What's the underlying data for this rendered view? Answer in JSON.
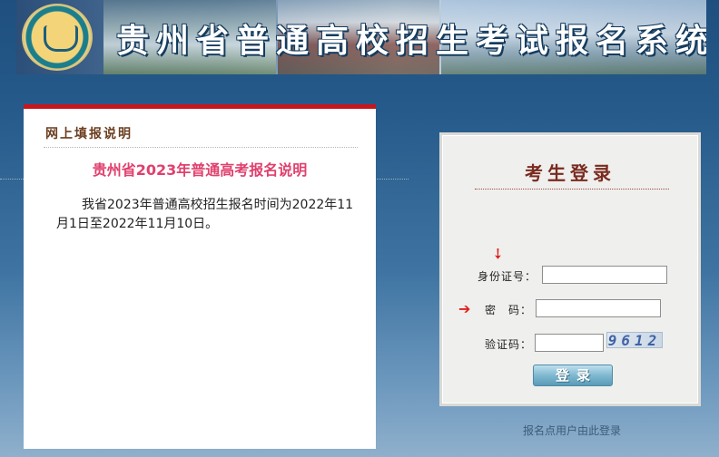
{
  "banner": {
    "title": "贵州省普通高校招生考试报名系统"
  },
  "notice": {
    "header": "网上填报说明",
    "title": "贵州省2023年普通高考报名说明",
    "body": "我省2023年普通高校招生报名时间为2022年11月1日至2022年11月10日。"
  },
  "login": {
    "title": "考生登录",
    "id_label": "身份证号：",
    "password_label": "密　码：",
    "captcha_label": "验证码：",
    "captcha_text": "9612",
    "submit_label": "登录",
    "id_value": "",
    "password_value": "",
    "captcha_value": ""
  },
  "footer": {
    "site_login_link": "报名点用户由此登录"
  },
  "colors": {
    "accent_red": "#c8161d",
    "notice_title_pink": "#e0406e",
    "login_title_brown": "#7a2a1f"
  }
}
